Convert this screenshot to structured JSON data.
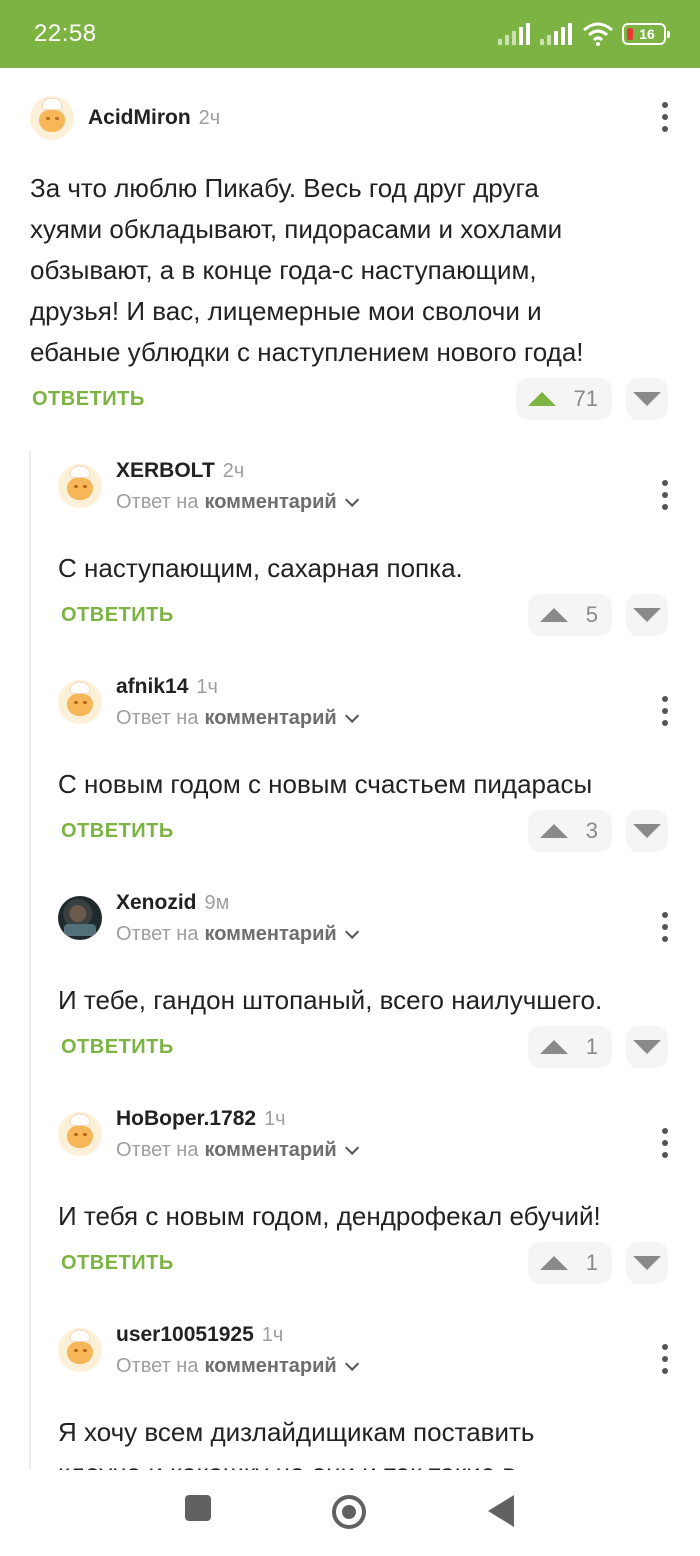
{
  "status_bar": {
    "time": "22:58",
    "battery": "16"
  },
  "comments": [
    {
      "user": "AcidMiron",
      "ago": "2ч",
      "reply_to": null,
      "text_lines": [
        "За что люблю Пикабу. Весь год друг друга",
        "хуями обкладывают, пидорасами и хохлами",
        "обзывают, а в конце года-с наступающим,",
        "друзья! И вас, лицемерные мои сволочи и",
        "ебаные ублюдки с наступлением нового года!"
      ],
      "reply_label": "ОТВЕТИТЬ",
      "rating": "71",
      "upvoted": true
    },
    {
      "user": "XERBOLT",
      "ago": "2ч",
      "reply_prefix": "Ответ на",
      "reply_target": "комментарий",
      "text_lines": [
        "С наступающим, сахарная попка."
      ],
      "reply_label": "ОТВЕТИТЬ",
      "rating": "5"
    },
    {
      "user": "afnik14",
      "ago": "1ч",
      "reply_prefix": "Ответ на",
      "reply_target": "комментарий",
      "text_lines": [
        "С новым годом с новым счастьем пидарасы"
      ],
      "reply_label": "ОТВЕТИТЬ",
      "rating": "3"
    },
    {
      "user": "Xenozid",
      "ago": "9м",
      "reply_prefix": "Ответ на",
      "reply_target": "комментарий",
      "text_lines": [
        "И тебе, гандон штопаный, всего наилучшего."
      ],
      "reply_label": "ОТВЕТИТЬ",
      "rating": "1"
    },
    {
      "user": "HoBoper.1782",
      "ago": "1ч",
      "reply_prefix": "Ответ на",
      "reply_target": "комментарий",
      "text_lines": [
        "И тебя с новым годом, дендрофекал ебучий!"
      ],
      "reply_label": "ОТВЕТИТЬ",
      "rating": "1"
    },
    {
      "user": "user10051925",
      "ago": "1ч",
      "reply_prefix": "Ответ на",
      "reply_target": "комментарий",
      "text_lines": [
        "Я хочу всем дизлайдищикам поставить",
        "клоуна и какашку но они и так такие в"
      ]
    }
  ],
  "colors": {
    "accent": "#7cb342",
    "muted": "#9e9e9e"
  },
  "icons": [
    "signal-icon",
    "wifi-icon",
    "battery-icon",
    "more-vert-icon",
    "upvote-icon",
    "downvote-icon",
    "chevron-down-icon",
    "nav-recents-icon",
    "nav-home-icon",
    "nav-back-icon"
  ]
}
